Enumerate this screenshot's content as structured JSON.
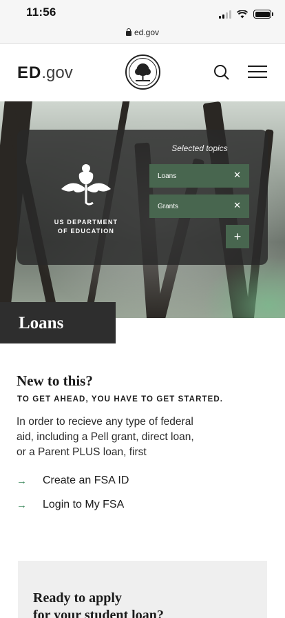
{
  "status_bar": {
    "time": "11:56",
    "url": "ed.gov"
  },
  "header": {
    "logo_main": "ED",
    "logo_suffix": ".gov",
    "seal_icon": "department-of-education-seal-icon",
    "search_icon": "search-icon",
    "menu_icon": "hamburger-menu-icon"
  },
  "hero": {
    "org_name_line1": "US DEPARTMENT",
    "org_name_line2": "OF EDUCATION",
    "logo_icon": "acorn-logo-icon",
    "selected_topics_label": "Selected topics",
    "topics": [
      {
        "label": "Loans",
        "remove_icon": "close-icon"
      },
      {
        "label": "Grants",
        "remove_icon": "close-icon"
      }
    ],
    "add_topic_label": "+",
    "accent_color": "#48664f"
  },
  "page_title": "Loans",
  "intro": {
    "title": "New to this?",
    "kicker": "TO GET AHEAD, YOU HAVE TO GET STARTED.",
    "body_line1": "In order to recieve any type of federal",
    "body_line2": "aid, including a Pell grant, direct loan,",
    "body_line3": "or a Parent PLUS loan, first",
    "links": [
      {
        "label": "Create an FSA ID",
        "icon": "arrow-right-icon"
      },
      {
        "label": "Login to My FSA",
        "icon": "arrow-right-icon"
      }
    ]
  },
  "apply_card": {
    "title_line1": "Ready to apply",
    "title_line2": "for your student loan?"
  }
}
